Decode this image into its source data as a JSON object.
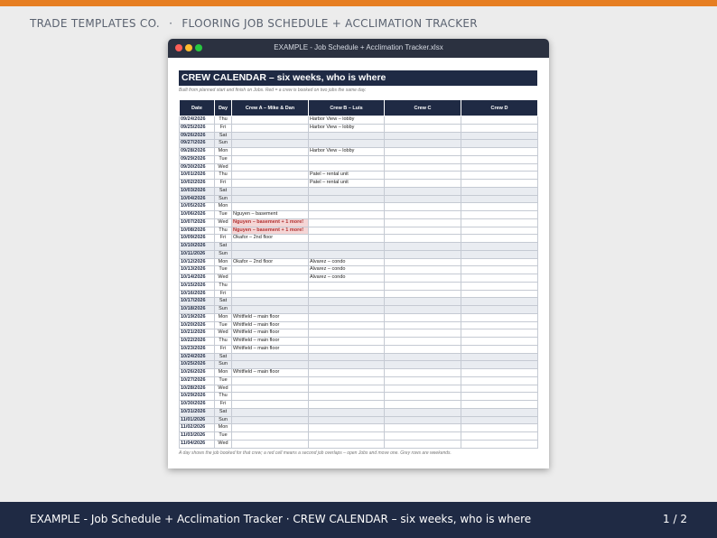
{
  "brand": {
    "company": "TRADE TEMPLATES CO.",
    "separator": "·",
    "product": "FLOORING JOB SCHEDULE + ACCLIMATION TRACKER"
  },
  "window": {
    "title": "EXAMPLE - Job Schedule + Acclimation Tracker.xlsx"
  },
  "sheet": {
    "banner": "CREW CALENDAR – six weeks, who is where",
    "subnote": "Built from planned start and finish on Jobs. Red = a crew is booked on two jobs the same day.",
    "columns": [
      "Date",
      "Day",
      "Crew A – Mike & Dan",
      "Crew B – Luis",
      "Crew C",
      "Crew D"
    ],
    "rows": [
      {
        "date": "09/24/2026",
        "day": "Thu",
        "a": "",
        "b": "Harbor View – lobby",
        "c": "",
        "d": "",
        "weekend": false,
        "a_overlap": false
      },
      {
        "date": "09/25/2026",
        "day": "Fri",
        "a": "",
        "b": "Harbor View – lobby",
        "c": "",
        "d": "",
        "weekend": false,
        "a_overlap": false
      },
      {
        "date": "09/26/2026",
        "day": "Sat",
        "a": "",
        "b": "",
        "c": "",
        "d": "",
        "weekend": true,
        "a_overlap": false
      },
      {
        "date": "09/27/2026",
        "day": "Sun",
        "a": "",
        "b": "",
        "c": "",
        "d": "",
        "weekend": true,
        "a_overlap": false
      },
      {
        "date": "09/28/2026",
        "day": "Mon",
        "a": "",
        "b": "Harbor View – lobby",
        "c": "",
        "d": "",
        "weekend": false,
        "a_overlap": false
      },
      {
        "date": "09/29/2026",
        "day": "Tue",
        "a": "",
        "b": "",
        "c": "",
        "d": "",
        "weekend": false,
        "a_overlap": false
      },
      {
        "date": "09/30/2026",
        "day": "Wed",
        "a": "",
        "b": "",
        "c": "",
        "d": "",
        "weekend": false,
        "a_overlap": false
      },
      {
        "date": "10/01/2026",
        "day": "Thu",
        "a": "",
        "b": "Patel – rental unit",
        "c": "",
        "d": "",
        "weekend": false,
        "a_overlap": false
      },
      {
        "date": "10/02/2026",
        "day": "Fri",
        "a": "",
        "b": "Patel – rental unit",
        "c": "",
        "d": "",
        "weekend": false,
        "a_overlap": false
      },
      {
        "date": "10/03/2026",
        "day": "Sat",
        "a": "",
        "b": "",
        "c": "",
        "d": "",
        "weekend": true,
        "a_overlap": false
      },
      {
        "date": "10/04/2026",
        "day": "Sun",
        "a": "",
        "b": "",
        "c": "",
        "d": "",
        "weekend": true,
        "a_overlap": false
      },
      {
        "date": "10/05/2026",
        "day": "Mon",
        "a": "",
        "b": "",
        "c": "",
        "d": "",
        "weekend": false,
        "a_overlap": false
      },
      {
        "date": "10/06/2026",
        "day": "Tue",
        "a": "Nguyen – basement",
        "b": "",
        "c": "",
        "d": "",
        "weekend": false,
        "a_overlap": false
      },
      {
        "date": "10/07/2026",
        "day": "Wed",
        "a": "Nguyen – basement  + 1 more!",
        "b": "",
        "c": "",
        "d": "",
        "weekend": false,
        "a_overlap": true
      },
      {
        "date": "10/08/2026",
        "day": "Thu",
        "a": "Nguyen – basement  + 1 more!",
        "b": "",
        "c": "",
        "d": "",
        "weekend": false,
        "a_overlap": true
      },
      {
        "date": "10/09/2026",
        "day": "Fri",
        "a": "Okafor – 2nd floor",
        "b": "",
        "c": "",
        "d": "",
        "weekend": false,
        "a_overlap": false
      },
      {
        "date": "10/10/2026",
        "day": "Sat",
        "a": "",
        "b": "",
        "c": "",
        "d": "",
        "weekend": true,
        "a_overlap": false
      },
      {
        "date": "10/11/2026",
        "day": "Sun",
        "a": "",
        "b": "",
        "c": "",
        "d": "",
        "weekend": true,
        "a_overlap": false
      },
      {
        "date": "10/12/2026",
        "day": "Mon",
        "a": "Okafor – 2nd floor",
        "b": "Alvarez – condo",
        "c": "",
        "d": "",
        "weekend": false,
        "a_overlap": false
      },
      {
        "date": "10/13/2026",
        "day": "Tue",
        "a": "",
        "b": "Alvarez – condo",
        "c": "",
        "d": "",
        "weekend": false,
        "a_overlap": false
      },
      {
        "date": "10/14/2026",
        "day": "Wed",
        "a": "",
        "b": "Alvarez – condo",
        "c": "",
        "d": "",
        "weekend": false,
        "a_overlap": false
      },
      {
        "date": "10/15/2026",
        "day": "Thu",
        "a": "",
        "b": "",
        "c": "",
        "d": "",
        "weekend": false,
        "a_overlap": false
      },
      {
        "date": "10/16/2026",
        "day": "Fri",
        "a": "",
        "b": "",
        "c": "",
        "d": "",
        "weekend": false,
        "a_overlap": false
      },
      {
        "date": "10/17/2026",
        "day": "Sat",
        "a": "",
        "b": "",
        "c": "",
        "d": "",
        "weekend": true,
        "a_overlap": false
      },
      {
        "date": "10/18/2026",
        "day": "Sun",
        "a": "",
        "b": "",
        "c": "",
        "d": "",
        "weekend": true,
        "a_overlap": false
      },
      {
        "date": "10/19/2026",
        "day": "Mon",
        "a": "Whitfield – main floor",
        "b": "",
        "c": "",
        "d": "",
        "weekend": false,
        "a_overlap": false
      },
      {
        "date": "10/20/2026",
        "day": "Tue",
        "a": "Whitfield – main floor",
        "b": "",
        "c": "",
        "d": "",
        "weekend": false,
        "a_overlap": false
      },
      {
        "date": "10/21/2026",
        "day": "Wed",
        "a": "Whitfield – main floor",
        "b": "",
        "c": "",
        "d": "",
        "weekend": false,
        "a_overlap": false
      },
      {
        "date": "10/22/2026",
        "day": "Thu",
        "a": "Whitfield – main floor",
        "b": "",
        "c": "",
        "d": "",
        "weekend": false,
        "a_overlap": false
      },
      {
        "date": "10/23/2026",
        "day": "Fri",
        "a": "Whitfield – main floor",
        "b": "",
        "c": "",
        "d": "",
        "weekend": false,
        "a_overlap": false
      },
      {
        "date": "10/24/2026",
        "day": "Sat",
        "a": "",
        "b": "",
        "c": "",
        "d": "",
        "weekend": true,
        "a_overlap": false
      },
      {
        "date": "10/25/2026",
        "day": "Sun",
        "a": "",
        "b": "",
        "c": "",
        "d": "",
        "weekend": true,
        "a_overlap": false
      },
      {
        "date": "10/26/2026",
        "day": "Mon",
        "a": "Whitfield – main floor",
        "b": "",
        "c": "",
        "d": "",
        "weekend": false,
        "a_overlap": false
      },
      {
        "date": "10/27/2026",
        "day": "Tue",
        "a": "",
        "b": "",
        "c": "",
        "d": "",
        "weekend": false,
        "a_overlap": false
      },
      {
        "date": "10/28/2026",
        "day": "Wed",
        "a": "",
        "b": "",
        "c": "",
        "d": "",
        "weekend": false,
        "a_overlap": false
      },
      {
        "date": "10/29/2026",
        "day": "Thu",
        "a": "",
        "b": "",
        "c": "",
        "d": "",
        "weekend": false,
        "a_overlap": false
      },
      {
        "date": "10/30/2026",
        "day": "Fri",
        "a": "",
        "b": "",
        "c": "",
        "d": "",
        "weekend": false,
        "a_overlap": false
      },
      {
        "date": "10/31/2026",
        "day": "Sat",
        "a": "",
        "b": "",
        "c": "",
        "d": "",
        "weekend": true,
        "a_overlap": false
      },
      {
        "date": "11/01/2026",
        "day": "Sun",
        "a": "",
        "b": "",
        "c": "",
        "d": "",
        "weekend": true,
        "a_overlap": false
      },
      {
        "date": "11/02/2026",
        "day": "Mon",
        "a": "",
        "b": "",
        "c": "",
        "d": "",
        "weekend": false,
        "a_overlap": false
      },
      {
        "date": "11/03/2026",
        "day": "Tue",
        "a": "",
        "b": "",
        "c": "",
        "d": "",
        "weekend": false,
        "a_overlap": false
      },
      {
        "date": "11/04/2026",
        "day": "Wed",
        "a": "",
        "b": "",
        "c": "",
        "d": "",
        "weekend": false,
        "a_overlap": false
      }
    ],
    "footnote": "A day shows the job booked for that crew; a red cell means a second job overlaps – open Jobs and move one. Grey rows are weekends."
  },
  "footer": {
    "caption": "EXAMPLE - Job Schedule + Acclimation Tracker · CREW CALENDAR – six weeks, who is where",
    "pager": "1 / 2"
  },
  "colors": {
    "accent": "#e67e22",
    "navy": "#1f2a44",
    "overlap_fill": "#f5d6d6",
    "overlap_text": "#b03030",
    "weekend_fill": "#e9ecf1"
  }
}
